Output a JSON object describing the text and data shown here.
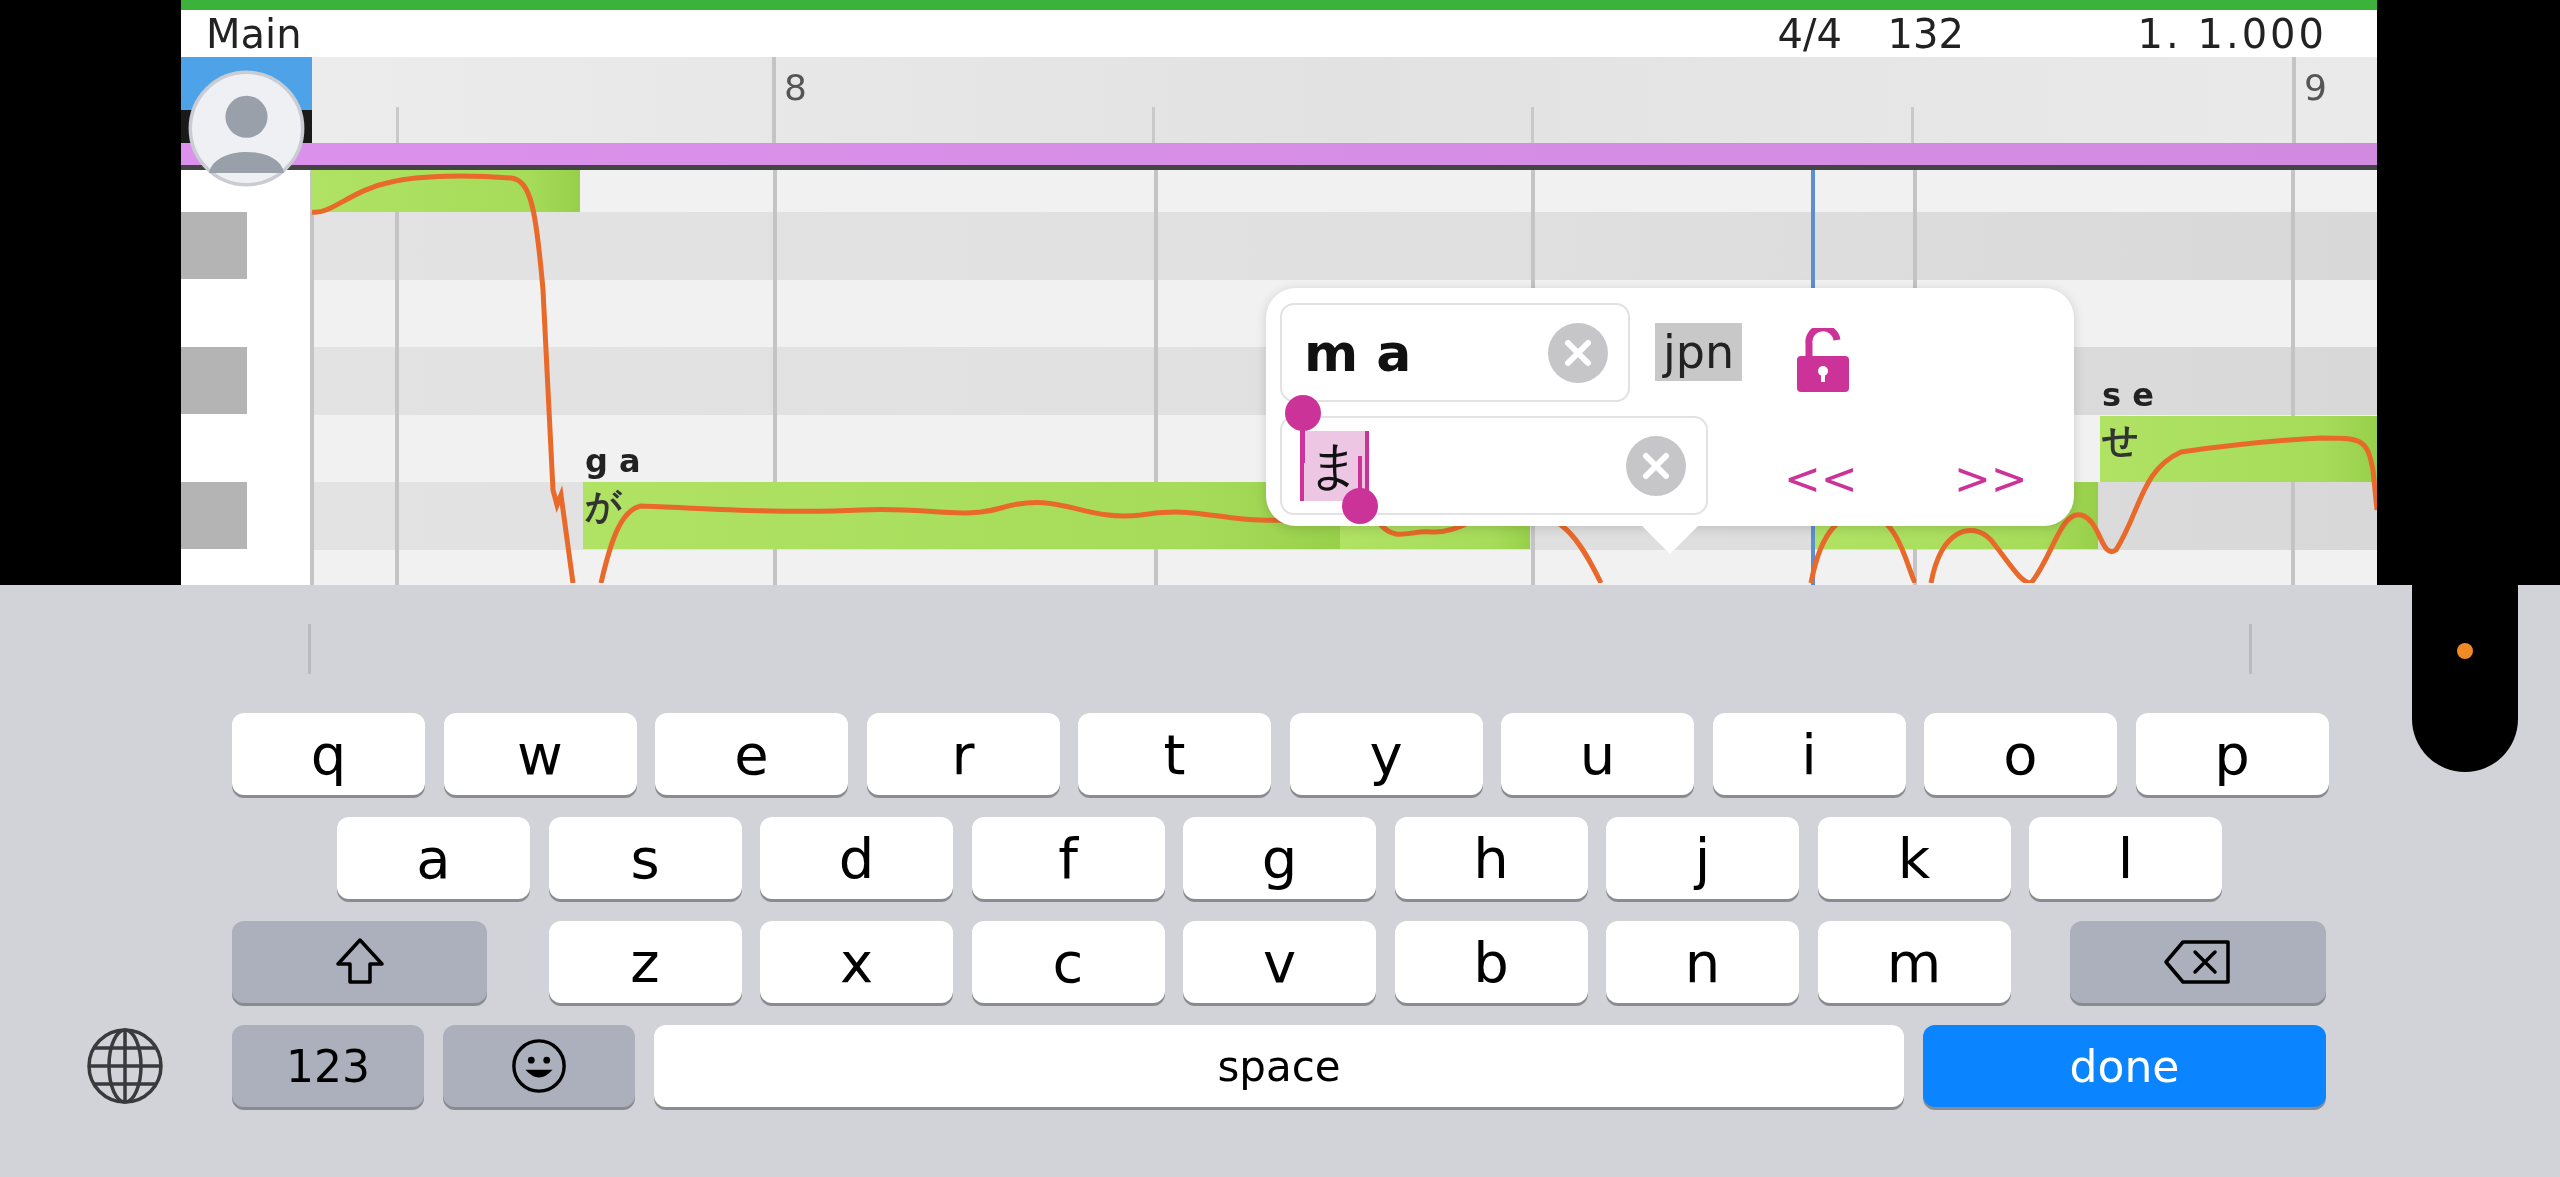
{
  "header": {
    "track": "Main",
    "time_signature": "4/4",
    "tempo": "132",
    "position": "1. 1.000"
  },
  "ruler": {
    "marks": [
      "8",
      "9"
    ]
  },
  "notes": [
    {
      "kind": "note"
    },
    {
      "kind": "note",
      "phoneme": "g a",
      "lyric": "が"
    },
    {
      "kind": "note"
    },
    {
      "kind": "note"
    },
    {
      "kind": "note",
      "phoneme": "s e",
      "lyric": "せ"
    }
  ],
  "popup": {
    "phoneme_field": {
      "value": "m a"
    },
    "lyric_field": {
      "value": "ま"
    },
    "language": "jpn",
    "locked": false,
    "prev": "<<",
    "next": ">>"
  },
  "keyboard": {
    "rows": [
      {
        "keys": [
          {
            "kind": "letter",
            "label": "q"
          },
          {
            "kind": "letter",
            "label": "w"
          },
          {
            "kind": "letter",
            "label": "e"
          },
          {
            "kind": "letter",
            "label": "r"
          },
          {
            "kind": "letter",
            "label": "t"
          },
          {
            "kind": "letter",
            "label": "y"
          },
          {
            "kind": "letter",
            "label": "u"
          },
          {
            "kind": "letter",
            "label": "i"
          },
          {
            "kind": "letter",
            "label": "o"
          },
          {
            "kind": "letter",
            "label": "p"
          }
        ]
      },
      {
        "keys": [
          {
            "kind": "letter",
            "label": "a"
          },
          {
            "kind": "letter",
            "label": "s"
          },
          {
            "kind": "letter",
            "label": "d"
          },
          {
            "kind": "letter",
            "label": "f"
          },
          {
            "kind": "letter",
            "label": "g"
          },
          {
            "kind": "letter",
            "label": "h"
          },
          {
            "kind": "letter",
            "label": "j"
          },
          {
            "kind": "letter",
            "label": "k"
          },
          {
            "kind": "letter",
            "label": "l"
          }
        ]
      },
      {
        "keys": [
          {
            "kind": "shift"
          },
          {
            "kind": "letter",
            "label": "z"
          },
          {
            "kind": "letter",
            "label": "x"
          },
          {
            "kind": "letter",
            "label": "c"
          },
          {
            "kind": "letter",
            "label": "v"
          },
          {
            "kind": "letter",
            "label": "b"
          },
          {
            "kind": "letter",
            "label": "n"
          },
          {
            "kind": "letter",
            "label": "m"
          },
          {
            "kind": "delete"
          }
        ]
      },
      {
        "keys": [
          {
            "kind": "globe"
          },
          {
            "kind": "numbers",
            "label": "123"
          },
          {
            "kind": "emoji"
          },
          {
            "kind": "space",
            "label": "space"
          },
          {
            "kind": "done",
            "label": "done"
          }
        ]
      }
    ]
  }
}
